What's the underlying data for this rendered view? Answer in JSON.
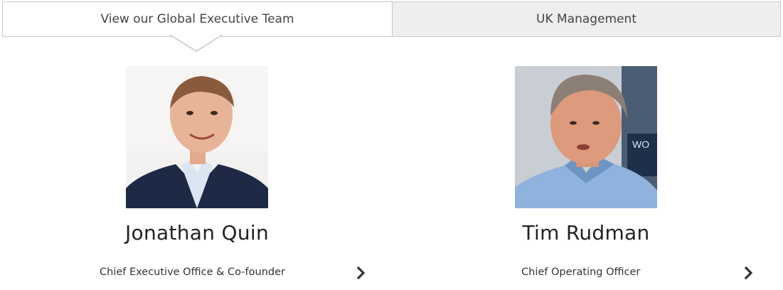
{
  "tabs": {
    "global": {
      "label": "View our Global Executive Team",
      "active": true
    },
    "uk": {
      "label": "UK Management",
      "active": false
    }
  },
  "people": [
    {
      "name": "Jonathan Quin",
      "role": "Chief Executive Office & Co-founder"
    },
    {
      "name": "Tim Rudman",
      "role": "Chief Operating Officer"
    }
  ],
  "icons": {
    "more": "chevron-right-icon"
  },
  "colors": {
    "tab_border": "#c8c8c8",
    "tab_inactive_bg": "#eeeeee",
    "text": "#222222"
  }
}
